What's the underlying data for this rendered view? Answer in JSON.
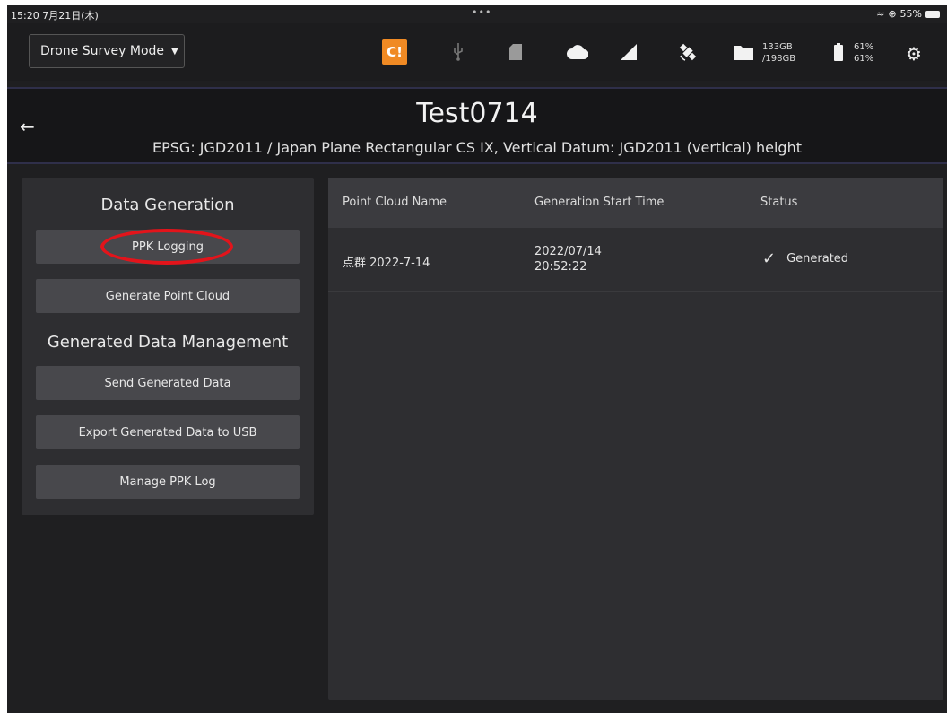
{
  "status_bar": {
    "time": "15:20  7月21日(木)",
    "dots": "•••",
    "battery_percent": "55%"
  },
  "toolbar": {
    "mode_label": "Drone Survey Mode",
    "storage_used": "133GB",
    "storage_total": "/198GB",
    "battery_1": "61%",
    "battery_2": "61%",
    "icons": [
      "alert-icon",
      "usb-icon",
      "sd-card-icon",
      "cloud-icon",
      "signal-icon",
      "satellite-icon",
      "folder-icon",
      "battery-icon",
      "gear-icon"
    ],
    "accent": "#f08a24"
  },
  "project": {
    "title": "Test0714",
    "subtitle": "EPSG: JGD2011 / Japan Plane Rectangular CS IX, Vertical Datum: JGD2011 (vertical) height"
  },
  "left_panel": {
    "data_generation_title": "Data Generation",
    "ppk_logging": "PPK Logging",
    "generate_point_cloud": "Generate Point Cloud",
    "management_title": "Generated Data Management",
    "send_generated_data": "Send Generated Data",
    "export_usb": "Export Generated Data to USB",
    "manage_ppk_log": "Manage PPK Log"
  },
  "table": {
    "headers": [
      "Point Cloud Name",
      "Generation Start Time",
      "Status"
    ],
    "rows": [
      {
        "name": "点群 2022-7-14",
        "date": "2022/07/14",
        "time": "20:52:22",
        "status": "Generated"
      }
    ]
  },
  "highlight_color": "#e3141b"
}
